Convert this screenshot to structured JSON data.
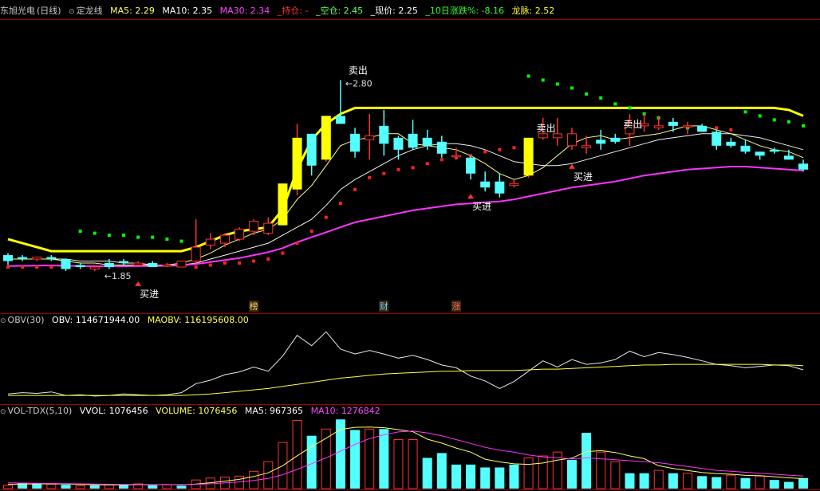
{
  "colors": {
    "bg": "#000000",
    "border": "#8b0000",
    "up": "#ff3333",
    "down": "#54ffff",
    "yellow": "#ffff00",
    "magenta": "#ff33ff",
    "green": "#00ff00",
    "white": "#ffffff",
    "dot_red": "#ff2222"
  },
  "header": {
    "stock_name": "东旭光电",
    "period": "(日线)",
    "indicator": "定龙线",
    "ma5": "MA5: 2.29",
    "ma10": "MA10: 2.35",
    "ma30": "MA30: 2.34",
    "hold": "_持仓: -",
    "empty": "_空仓: 2.45",
    "price": "_现价: 2.25",
    "change10": "_10日涨跌%: -8.16",
    "longmai": "龙脉: 2.52"
  },
  "obv_header": {
    "title": "OBV(30)",
    "obv": "OBV: 114671944.00",
    "maobv": "MAOBV: 116195608.00"
  },
  "vol_header": {
    "title": "VOL-TDX(5,10)",
    "vvol": "VVOL: 1076456",
    "volume": "VOLUME: 1076456",
    "ma5": "MA5: 967365",
    "ma10": "MA10: 1276842"
  },
  "chart_data": [
    {
      "type": "candlestick",
      "title": "东旭光电 (日线) 定龙线",
      "candles": [
        {
          "o": 1.92,
          "h": 1.93,
          "l": 1.87,
          "c": 1.89
        },
        {
          "o": 1.91,
          "h": 1.92,
          "l": 1.89,
          "c": 1.9
        },
        {
          "o": 1.9,
          "h": 1.91,
          "l": 1.89,
          "c": 1.91
        },
        {
          "o": 1.91,
          "h": 1.92,
          "l": 1.89,
          "c": 1.9
        },
        {
          "o": 1.9,
          "h": 1.9,
          "l": 1.84,
          "c": 1.85
        },
        {
          "o": 1.87,
          "h": 1.88,
          "l": 1.85,
          "c": 1.86
        },
        {
          "o": 1.85,
          "h": 1.86,
          "l": 1.84,
          "c": 1.86
        },
        {
          "o": 1.88,
          "h": 1.9,
          "l": 1.85,
          "c": 1.86
        },
        {
          "o": 1.89,
          "h": 1.9,
          "l": 1.87,
          "c": 1.88
        },
        {
          "o": 1.87,
          "h": 1.89,
          "l": 1.86,
          "c": 1.88
        },
        {
          "o": 1.88,
          "h": 1.89,
          "l": 1.86,
          "c": 1.86
        },
        {
          "o": 1.87,
          "h": 1.88,
          "l": 1.86,
          "c": 1.87
        },
        {
          "o": 1.86,
          "h": 1.89,
          "l": 1.86,
          "c": 1.89
        },
        {
          "o": 1.89,
          "h": 2.1,
          "l": 1.88,
          "c": 1.96
        },
        {
          "o": 1.97,
          "h": 2.03,
          "l": 1.95,
          "c": 2.0
        },
        {
          "o": 1.98,
          "h": 2.03,
          "l": 1.96,
          "c": 2.02
        },
        {
          "o": 2.0,
          "h": 2.06,
          "l": 1.99,
          "c": 2.05
        },
        {
          "o": 2.04,
          "h": 2.1,
          "l": 2.02,
          "c": 2.09
        },
        {
          "o": 2.03,
          "h": 2.11,
          "l": 2.02,
          "c": 2.08
        },
        {
          "o": 2.07,
          "h": 2.28,
          "l": 2.07,
          "c": 2.28
        },
        {
          "o": 2.25,
          "h": 2.58,
          "l": 2.22,
          "c": 2.51
        },
        {
          "o": 2.53,
          "h": 2.53,
          "l": 2.32,
          "c": 2.37
        },
        {
          "o": 2.4,
          "h": 2.62,
          "l": 2.39,
          "c": 2.62
        },
        {
          "o": 2.62,
          "h": 2.8,
          "l": 2.58,
          "c": 2.58
        },
        {
          "o": 2.53,
          "h": 2.56,
          "l": 2.41,
          "c": 2.44
        },
        {
          "o": 2.5,
          "h": 2.63,
          "l": 2.4,
          "c": 2.52
        },
        {
          "o": 2.57,
          "h": 2.65,
          "l": 2.42,
          "c": 2.48
        },
        {
          "o": 2.51,
          "h": 2.52,
          "l": 2.4,
          "c": 2.45
        },
        {
          "o": 2.53,
          "h": 2.6,
          "l": 2.45,
          "c": 2.46
        },
        {
          "o": 2.51,
          "h": 2.55,
          "l": 2.45,
          "c": 2.47
        },
        {
          "o": 2.49,
          "h": 2.52,
          "l": 2.41,
          "c": 2.43
        },
        {
          "o": 2.42,
          "h": 2.46,
          "l": 2.4,
          "c": 2.42
        },
        {
          "o": 2.41,
          "h": 2.42,
          "l": 2.3,
          "c": 2.33
        },
        {
          "o": 2.29,
          "h": 2.34,
          "l": 2.24,
          "c": 2.26
        },
        {
          "o": 2.29,
          "h": 2.33,
          "l": 2.21,
          "c": 2.23
        },
        {
          "o": 2.27,
          "h": 2.3,
          "l": 2.26,
          "c": 2.28
        },
        {
          "o": 2.32,
          "h": 2.51,
          "l": 2.31,
          "c": 2.51
        },
        {
          "o": 2.51,
          "h": 2.61,
          "l": 2.5,
          "c": 2.53
        },
        {
          "o": 2.51,
          "h": 2.61,
          "l": 2.47,
          "c": 2.53
        },
        {
          "o": 2.47,
          "h": 2.56,
          "l": 2.45,
          "c": 2.53
        },
        {
          "o": 2.46,
          "h": 2.52,
          "l": 2.43,
          "c": 2.47
        },
        {
          "o": 2.5,
          "h": 2.55,
          "l": 2.45,
          "c": 2.48
        },
        {
          "o": 2.51,
          "h": 2.53,
          "l": 2.48,
          "c": 2.49
        },
        {
          "o": 2.53,
          "h": 2.63,
          "l": 2.47,
          "c": 2.58
        },
        {
          "o": 2.57,
          "h": 2.63,
          "l": 2.54,
          "c": 2.58
        },
        {
          "o": 2.56,
          "h": 2.62,
          "l": 2.55,
          "c": 2.57
        },
        {
          "o": 2.59,
          "h": 2.61,
          "l": 2.54,
          "c": 2.57
        },
        {
          "o": 2.57,
          "h": 2.59,
          "l": 2.53,
          "c": 2.57
        },
        {
          "o": 2.57,
          "h": 2.58,
          "l": 2.54,
          "c": 2.54
        },
        {
          "o": 2.54,
          "h": 2.55,
          "l": 2.45,
          "c": 2.47
        },
        {
          "o": 2.49,
          "h": 2.51,
          "l": 2.46,
          "c": 2.47
        },
        {
          "o": 2.47,
          "h": 2.5,
          "l": 2.43,
          "c": 2.44
        },
        {
          "o": 2.44,
          "h": 2.44,
          "l": 2.4,
          "c": 2.42
        },
        {
          "o": 2.45,
          "h": 2.46,
          "l": 2.43,
          "c": 2.44
        },
        {
          "o": 2.42,
          "h": 2.45,
          "l": 2.4,
          "c": 2.4
        },
        {
          "o": 2.38,
          "h": 2.4,
          "l": 2.34,
          "c": 2.35
        }
      ],
      "ma30": [
        1.865,
        1.866,
        1.867,
        1.868,
        1.866,
        1.865,
        1.864,
        1.863,
        1.864,
        1.865,
        1.865,
        1.866,
        1.868,
        1.875,
        1.885,
        1.895,
        1.905,
        1.92,
        1.935,
        1.955,
        1.985,
        2.01,
        2.035,
        2.06,
        2.085,
        2.1,
        2.115,
        2.13,
        2.145,
        2.155,
        2.165,
        2.175,
        2.18,
        2.185,
        2.19,
        2.2,
        2.215,
        2.23,
        2.245,
        2.26,
        2.27,
        2.28,
        2.29,
        2.305,
        2.32,
        2.33,
        2.34,
        2.35,
        2.355,
        2.36,
        2.365,
        2.365,
        2.36,
        2.355,
        2.35,
        2.345
      ],
      "ma5": [
        1.9,
        1.9,
        1.9,
        1.9,
        1.89,
        1.88,
        1.88,
        1.87,
        1.87,
        1.87,
        1.87,
        1.87,
        1.88,
        1.9,
        1.93,
        1.97,
        2.0,
        2.03,
        2.05,
        2.1,
        2.2,
        2.27,
        2.37,
        2.47,
        2.5,
        2.51,
        2.53,
        2.53,
        2.48,
        2.47,
        2.46,
        2.45,
        2.42,
        2.38,
        2.33,
        2.3,
        2.32,
        2.36,
        2.42,
        2.48,
        2.51,
        2.52,
        2.5,
        2.51,
        2.52,
        2.53,
        2.55,
        2.57,
        2.57,
        2.55,
        2.53,
        2.5,
        2.47,
        2.45,
        2.44,
        2.41
      ],
      "ma10": [
        1.9,
        1.9,
        1.9,
        1.9,
        1.9,
        1.89,
        1.89,
        1.89,
        1.88,
        1.88,
        1.87,
        1.87,
        1.87,
        1.88,
        1.9,
        1.92,
        1.94,
        1.96,
        1.98,
        2.02,
        2.06,
        2.1,
        2.17,
        2.25,
        2.3,
        2.34,
        2.38,
        2.42,
        2.45,
        2.47,
        2.48,
        2.48,
        2.47,
        2.45,
        2.42,
        2.39,
        2.38,
        2.37,
        2.37,
        2.38,
        2.4,
        2.42,
        2.44,
        2.46,
        2.48,
        2.5,
        2.51,
        2.52,
        2.53,
        2.53,
        2.53,
        2.52,
        2.51,
        2.49,
        2.47,
        2.45
      ],
      "longmai": [
        2.0,
        1.98,
        1.96,
        1.94,
        1.94,
        1.94,
        1.94,
        1.94,
        1.94,
        1.94,
        1.94,
        1.94,
        1.94,
        1.96,
        1.99,
        2.02,
        2.04,
        2.05,
        2.06,
        2.15,
        2.35,
        2.5,
        2.58,
        2.63,
        2.66,
        2.66,
        2.66,
        2.66,
        2.66,
        2.66,
        2.66,
        2.66,
        2.66,
        2.66,
        2.66,
        2.66,
        2.66,
        2.66,
        2.66,
        2.66,
        2.66,
        2.66,
        2.66,
        2.66,
        2.66,
        2.66,
        2.66,
        2.66,
        2.66,
        2.66,
        2.66,
        2.66,
        2.66,
        2.66,
        2.65,
        2.62
      ],
      "sar": [
        1.86,
        1.86,
        1.86,
        1.86,
        1.86,
        2.04,
        2.03,
        2.02,
        2.02,
        2.01,
        2.01,
        2.0,
        1.99,
        1.86,
        1.87,
        1.88,
        1.88,
        1.89,
        1.9,
        1.93,
        1.98,
        2.04,
        2.11,
        2.18,
        2.25,
        2.31,
        2.33,
        2.35,
        2.36,
        2.38,
        2.4,
        2.41,
        2.42,
        2.44,
        2.45,
        2.46,
        2.82,
        2.8,
        2.78,
        2.76,
        2.73,
        2.71,
        2.68,
        2.66,
        2.63,
        2.61,
        2.58,
        2.56,
        2.55,
        2.56,
        2.55,
        2.64,
        2.62,
        2.6,
        2.59,
        2.57
      ],
      "sar_side": [
        "s",
        "s",
        "s",
        "s",
        "s",
        "r",
        "r",
        "r",
        "r",
        "r",
        "r",
        "r",
        "r",
        "s",
        "s",
        "s",
        "s",
        "s",
        "s",
        "s",
        "s",
        "s",
        "s",
        "s",
        "s",
        "s",
        "s",
        "s",
        "s",
        "s",
        "s",
        "s",
        "s",
        "s",
        "s",
        "s",
        "r",
        "r",
        "r",
        "r",
        "r",
        "r",
        "r",
        "r",
        "r",
        "r",
        "r",
        "r",
        "s",
        "s",
        "s",
        "r",
        "r",
        "r",
        "r",
        "r"
      ],
      "annotations": [
        {
          "i": 6,
          "label": "1.85",
          "kind": "low"
        },
        {
          "i": 23,
          "label": "2.80",
          "kind": "high"
        },
        {
          "i": 9,
          "label": "买进",
          "kind": "buy"
        },
        {
          "i": 32,
          "label": "买进",
          "kind": "buy"
        },
        {
          "i": 39,
          "label": "买进",
          "kind": "buy"
        },
        {
          "i": 23,
          "label": "卖出",
          "kind": "sell"
        },
        {
          "i": 36,
          "label": "卖出",
          "kind": "sell"
        },
        {
          "i": 42,
          "label": "卖出",
          "kind": "sell"
        }
      ],
      "event_marks": [
        {
          "i": 17,
          "label": "榜",
          "color": "#ffcc66"
        },
        {
          "i": 26,
          "label": "财",
          "color": "#66ccff"
        },
        {
          "i": 31,
          "label": "涨",
          "color": "#ff6666"
        }
      ]
    },
    {
      "type": "line",
      "title": "OBV(30)",
      "series": [
        {
          "name": "OBV",
          "values": [
            1.0,
            1.2,
            1.1,
            1.3,
            0.8,
            0.9,
            0.7,
            0.8,
            1.0,
            0.9,
            0.8,
            0.9,
            1.2,
            2.5,
            3.0,
            3.8,
            4.2,
            4.9,
            4.3,
            6.5,
            9.5,
            8.0,
            10.0,
            7.5,
            6.8,
            7.3,
            6.8,
            6.2,
            6.6,
            6.0,
            5.2,
            4.8,
            3.6,
            2.9,
            1.8,
            2.8,
            4.3,
            5.8,
            4.9,
            6.0,
            5.3,
            5.5,
            6.0,
            7.2,
            6.4,
            7.0,
            6.7,
            6.3,
            5.8,
            5.3,
            5.1,
            4.8,
            5.0,
            5.2,
            5.1,
            4.5
          ]
        },
        {
          "name": "MAOBV",
          "values": [
            0.8,
            0.8,
            0.8,
            0.8,
            0.8,
            0.8,
            0.8,
            0.8,
            0.8,
            0.8,
            0.8,
            0.8,
            0.8,
            0.9,
            1.0,
            1.2,
            1.4,
            1.6,
            1.8,
            2.1,
            2.4,
            2.7,
            3.0,
            3.3,
            3.5,
            3.7,
            3.9,
            4.0,
            4.1,
            4.2,
            4.3,
            4.3,
            4.4,
            4.4,
            4.4,
            4.4,
            4.5,
            4.6,
            4.6,
            4.7,
            4.8,
            4.9,
            5.0,
            5.1,
            5.2,
            5.2,
            5.3,
            5.3,
            5.3,
            5.3,
            5.3,
            5.3,
            5.3,
            5.2,
            5.2,
            5.1
          ]
        }
      ]
    },
    {
      "type": "bar",
      "title": "VOL-TDX(5,10)",
      "volume": [
        0.35,
        0.6,
        0.55,
        0.45,
        0.4,
        0.3,
        0.35,
        0.4,
        0.45,
        0.5,
        0.35,
        0.4,
        0.3,
        0.9,
        1.1,
        1.2,
        1.3,
        1.8,
        2.8,
        4.8,
        7.1,
        5.5,
        6.2,
        7.2,
        6.1,
        6.2,
        6.2,
        5.1,
        5.1,
        3.2,
        3.7,
        2.5,
        2.5,
        2.2,
        2.2,
        2.5,
        3.2,
        3.4,
        3.8,
        3.0,
        5.8,
        3.8,
        2.8,
        1.6,
        1.6,
        1.9,
        1.6,
        1.6,
        1.3,
        1.2,
        1.4,
        1.1,
        1.3,
        0.9,
        0.7,
        1.1
      ],
      "updown": [
        "u",
        "d",
        "d",
        "u",
        "d",
        "u",
        "d",
        "u",
        "d",
        "u",
        "d",
        "u",
        "d",
        "u",
        "u",
        "u",
        "u",
        "u",
        "u",
        "u",
        "u",
        "d",
        "u",
        "d",
        "d",
        "u",
        "d",
        "u",
        "u",
        "d",
        "d",
        "d",
        "d",
        "d",
        "d",
        "d",
        "u",
        "u",
        "u",
        "d",
        "d",
        "u",
        "u",
        "d",
        "d",
        "u",
        "d",
        "u",
        "d",
        "d",
        "u",
        "d",
        "u",
        "d",
        "d",
        "d"
      ],
      "series": [
        {
          "name": "MA5",
          "values": [
            0.45,
            0.47,
            0.49,
            0.5,
            0.47,
            0.44,
            0.41,
            0.38,
            0.39,
            0.41,
            0.41,
            0.42,
            0.4,
            0.48,
            0.61,
            0.78,
            0.96,
            1.26,
            1.64,
            2.38,
            3.42,
            4.36,
            5.24,
            6.16,
            6.38,
            6.4,
            6.34,
            6.14,
            5.92,
            5.14,
            4.74,
            4.22,
            3.8,
            3.06,
            2.78,
            2.58,
            2.52,
            2.66,
            2.96,
            3.18,
            3.84,
            3.96,
            3.76,
            3.4,
            3.12,
            2.38,
            2.1,
            1.88,
            1.68,
            1.56,
            1.5,
            1.38,
            1.34,
            1.24,
            1.12,
            1.04
          ]
        },
        {
          "name": "MA10",
          "values": [
            0.6,
            0.58,
            0.56,
            0.54,
            0.52,
            0.5,
            0.48,
            0.46,
            0.44,
            0.43,
            0.42,
            0.42,
            0.42,
            0.45,
            0.5,
            0.6,
            0.7,
            0.85,
            1.05,
            1.45,
            2.0,
            2.6,
            3.2,
            3.9,
            4.6,
            5.2,
            5.6,
            5.9,
            6.0,
            5.8,
            5.5,
            5.1,
            4.7,
            4.3,
            4.0,
            3.8,
            3.5,
            3.3,
            3.2,
            3.1,
            3.2,
            3.1,
            3.0,
            2.9,
            2.8,
            2.7,
            2.5,
            2.3,
            2.1,
            1.9,
            1.8,
            1.7,
            1.6,
            1.5,
            1.4,
            1.3
          ]
        }
      ]
    }
  ]
}
